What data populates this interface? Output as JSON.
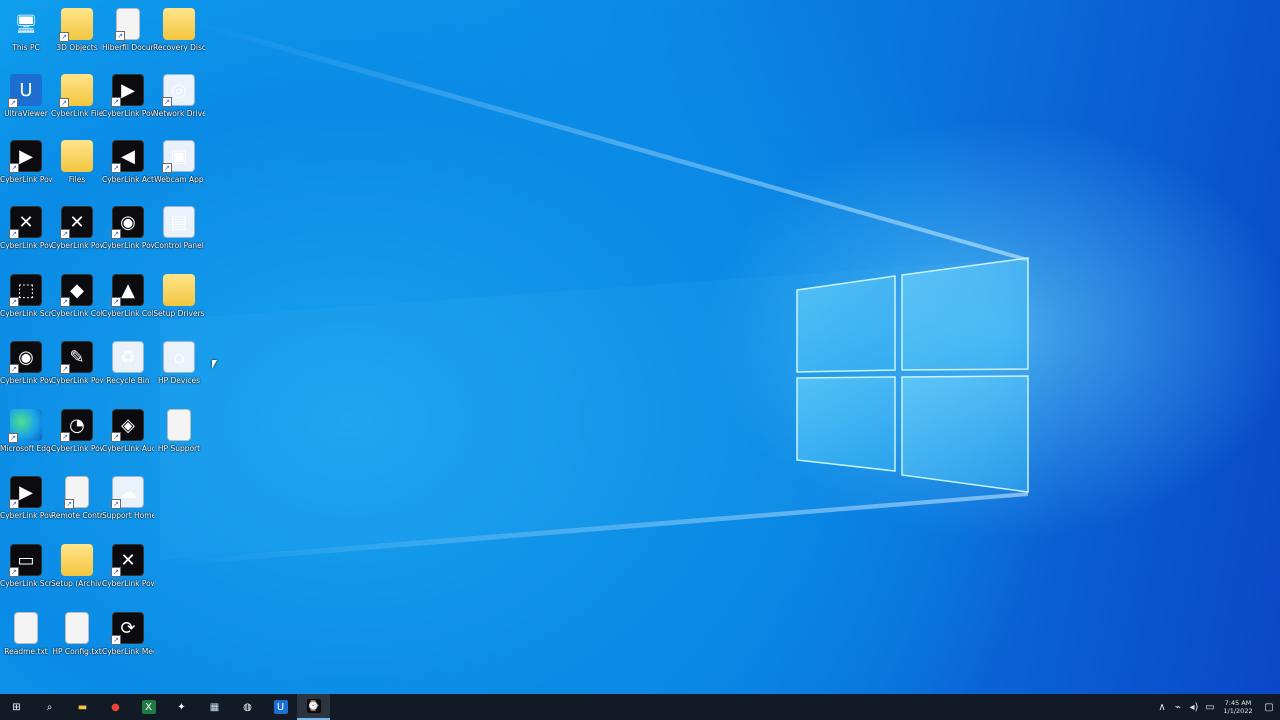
{
  "desktop": {
    "icons": [
      {
        "label": "This PC",
        "kind": "pc",
        "glyph": "🖥",
        "shortcut": false
      },
      {
        "label": "3D Objects",
        "kind": "folder",
        "glyph": "",
        "shortcut": true
      },
      {
        "label": "Hiberfil Document",
        "kind": "doc",
        "glyph": "",
        "shortcut": true
      },
      {
        "label": "Recovery Discs",
        "kind": "folder",
        "glyph": "",
        "shortcut": false
      },
      {
        "label": "UltraViewer",
        "kind": "blue",
        "glyph": "U",
        "shortcut": true
      },
      {
        "label": "CyberLink Files",
        "kind": "folder",
        "glyph": "",
        "shortcut": true
      },
      {
        "label": "CyberLink PowerDirector",
        "kind": "dark",
        "glyph": "▶",
        "shortcut": true
      },
      {
        "label": "Network Drivers",
        "kind": "light",
        "glyph": "◎",
        "shortcut": true
      },
      {
        "label": "CyberLink PowerDVD 20",
        "kind": "dark",
        "glyph": "▶",
        "shortcut": true
      },
      {
        "label": "Files",
        "kind": "folder",
        "glyph": "",
        "shortcut": false
      },
      {
        "label": "CyberLink ActionDirector",
        "kind": "dark",
        "glyph": "◀",
        "shortcut": true
      },
      {
        "label": "Webcam App",
        "kind": "light",
        "glyph": "▣",
        "shortcut": true
      },
      {
        "label": "CyberLink PowerDirector",
        "kind": "dark",
        "glyph": "✕",
        "shortcut": true
      },
      {
        "label": "CyberLink PowerDirector",
        "kind": "dark",
        "glyph": "✕",
        "shortcut": true
      },
      {
        "label": "CyberLink PowerDVD Remote",
        "kind": "dark",
        "glyph": "◉",
        "shortcut": true
      },
      {
        "label": "Control Panel",
        "kind": "light",
        "glyph": "▤",
        "shortcut": false
      },
      {
        "label": "CyberLink Screen Recorder",
        "kind": "dark",
        "glyph": "⬚",
        "shortcut": true
      },
      {
        "label": "CyberLink ColorDirector",
        "kind": "dark",
        "glyph": "◆",
        "shortcut": true
      },
      {
        "label": "CyberLink ColorDirector",
        "kind": "dark",
        "glyph": "▲",
        "shortcut": true
      },
      {
        "label": "Setup Drivers",
        "kind": "folder",
        "glyph": "",
        "shortcut": false
      },
      {
        "label": "CyberLink PowerDVD Remote",
        "kind": "dark",
        "glyph": "◉",
        "shortcut": true
      },
      {
        "label": "CyberLink PowerDirector",
        "kind": "dark",
        "glyph": "✎",
        "shortcut": true
      },
      {
        "label": "Recycle Bin",
        "kind": "light",
        "glyph": "♻",
        "shortcut": false
      },
      {
        "label": "HP Devices",
        "kind": "light",
        "glyph": "⌂",
        "shortcut": false
      },
      {
        "label": "Microsoft Edge",
        "kind": "edge",
        "glyph": "",
        "shortcut": true
      },
      {
        "label": "CyberLink PowerDVD 20",
        "kind": "dark",
        "glyph": "◔",
        "shortcut": true
      },
      {
        "label": "CyberLink AudioDirector",
        "kind": "dark",
        "glyph": "◈",
        "shortcut": true
      },
      {
        "label": "HP Support",
        "kind": "doc",
        "glyph": "",
        "shortcut": false
      },
      {
        "label": "CyberLink PowerDVD 20",
        "kind": "dark",
        "glyph": "▶",
        "shortcut": true
      },
      {
        "label": "Remote Control",
        "kind": "doc",
        "glyph": "",
        "shortcut": true
      },
      {
        "label": "Support Home",
        "kind": "light",
        "glyph": "☁",
        "shortcut": true
      },
      {
        "label": "CyberLink Screen Recorder",
        "kind": "dark",
        "glyph": "▭",
        "shortcut": true
      },
      {
        "label": "Setup (Archive)",
        "kind": "folder",
        "glyph": "",
        "shortcut": false
      },
      {
        "label": "CyberLink PowerDirector",
        "kind": "dark",
        "glyph": "✕",
        "shortcut": true
      },
      {
        "label": "Readme.txt",
        "kind": "doc",
        "glyph": "",
        "shortcut": false
      },
      {
        "label": "HP Config.txt",
        "kind": "doc",
        "glyph": "",
        "shortcut": false
      },
      {
        "label": "CyberLink MediaEspresso",
        "kind": "dark",
        "glyph": "⟳",
        "shortcut": true
      }
    ]
  },
  "taskbar": {
    "buttons": [
      {
        "name": "start-button",
        "glyph": "⊞",
        "color": "#ffffff",
        "bg": "transparent",
        "active": false
      },
      {
        "name": "search-button",
        "glyph": "⌕",
        "color": "#ffffff",
        "bg": "transparent",
        "active": false
      },
      {
        "name": "file-explorer-button",
        "glyph": "▬",
        "color": "#f3c640",
        "bg": "transparent",
        "active": false
      },
      {
        "name": "chrome-button",
        "glyph": "●",
        "color": "#e94335",
        "bg": "transparent",
        "active": false
      },
      {
        "name": "excel-button",
        "glyph": "X",
        "color": "#ffffff",
        "bg": "#1f7a45",
        "active": false
      },
      {
        "name": "settings-button",
        "glyph": "✦",
        "color": "#ffffff",
        "bg": "transparent",
        "active": false
      },
      {
        "name": "store-button",
        "glyph": "▦",
        "color": "#cfe3f5",
        "bg": "transparent",
        "active": false
      },
      {
        "name": "media-player-button",
        "glyph": "◍",
        "color": "#ffffff",
        "bg": "transparent",
        "active": false
      },
      {
        "name": "ultraviewer-taskbar-button",
        "glyph": "U",
        "color": "#ffffff",
        "bg": "#1c6fd0",
        "active": false
      },
      {
        "name": "active-app-button",
        "glyph": "⌚",
        "color": "#ffffff",
        "bg": "#0b0b10",
        "active": true
      }
    ],
    "tray": {
      "icons": [
        {
          "name": "chevron-up-icon",
          "glyph": "∧"
        },
        {
          "name": "usb-icon",
          "glyph": "⌁"
        },
        {
          "name": "volume-icon",
          "glyph": "◂)"
        },
        {
          "name": "network-icon",
          "glyph": "▭"
        }
      ],
      "time": "7:45 AM",
      "date": "1/1/2022",
      "notification_glyph": "▢"
    }
  }
}
